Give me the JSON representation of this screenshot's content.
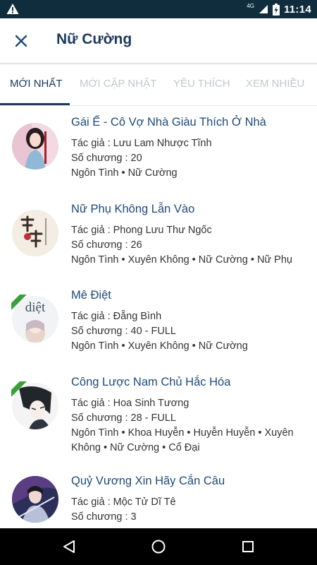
{
  "status": {
    "network": "4G",
    "time": "11:14"
  },
  "header": {
    "title": "Nữ Cường"
  },
  "tabs": [
    {
      "label": "MỚI NHẤT"
    },
    {
      "label": "MỚI CẬP NHẬT"
    },
    {
      "label": "YÊU THÍCH"
    },
    {
      "label": "XEM NHIỀU"
    }
  ],
  "books": [
    {
      "title": "Gái Ế - Cô Vợ Nhà Giàu Thích Ở Nhà",
      "author": "Tác giả : Lưu Lam Nhược Tĩnh",
      "chapters": "Số chương : 20",
      "genres": "Ngôn Tình • Nữ Cường"
    },
    {
      "title": "Nữ Phụ Không Lẫn Vào",
      "author": "Tác giả : Phong Lưu Thư Ngốc",
      "chapters": "Số chương : 26",
      "genres": "Ngôn Tình • Xuyên Không • Nữ Cường • Nữ Phụ"
    },
    {
      "title": "Mê Điệt",
      "author": "Tác giả : Đẵng Bình",
      "chapters": "Số chương : 40 - FULL",
      "genres": "Ngôn Tình • Xuyên Không • Nữ Cường",
      "cover_text": "diệt",
      "badge": "FULL"
    },
    {
      "title": "Công Lược Nam Chủ Hắc Hóa",
      "author": "Tác giả : Hoa Sinh Tương",
      "chapters": "Số chương : 28 - FULL",
      "genres_line1": "Ngôn Tình • Khoa Huyễn • Huyễn Huyễn • Xuyên",
      "genres_line2": "Không • Nữ Cường • Cổ Đại",
      "badge": "FULL"
    },
    {
      "title": "Quỷ Vương Xin Hãy Cắn Câu",
      "author": "Tác giả : Mộc Tử Dĩ Tê",
      "chapters": "Số chương : 3"
    }
  ],
  "colors": {
    "status_bar": "#0f2d3d",
    "title": "#1a3a5c",
    "book_title": "#1d4a7a",
    "badge": "#3aa03a"
  }
}
